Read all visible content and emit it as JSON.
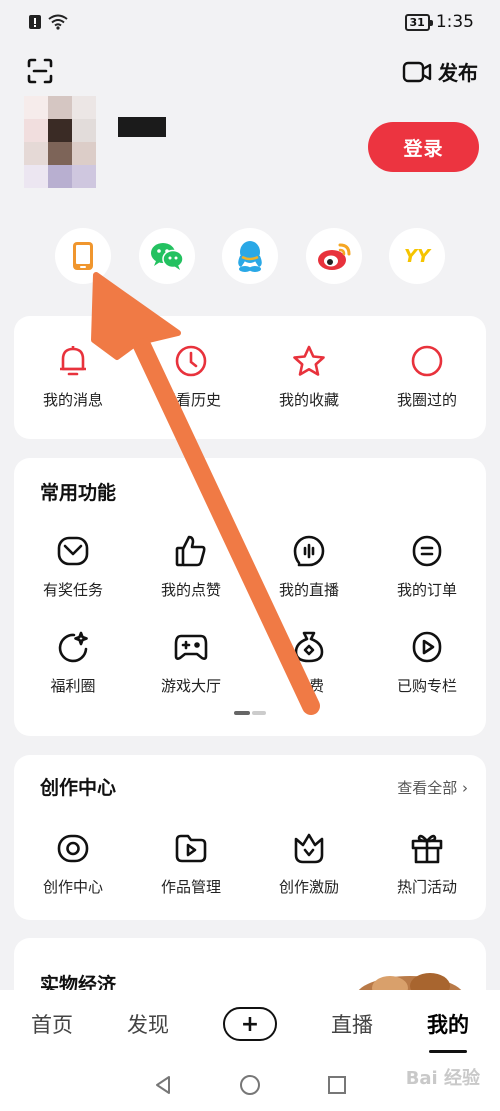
{
  "status_bar": {
    "battery": "31",
    "time": "1:35"
  },
  "header": {
    "publish_label": "发布"
  },
  "profile": {
    "login_label": "登录"
  },
  "social": [
    {
      "icon": "phone-icon",
      "color": "#f0962e"
    },
    {
      "icon": "wechat-icon",
      "color": "#23c160"
    },
    {
      "icon": "qq-icon",
      "color": "#2aa8e6"
    },
    {
      "icon": "weibo-icon",
      "color": "#e8323c"
    },
    {
      "icon": "yy-icon",
      "color": "#f5c400",
      "text": "YY"
    }
  ],
  "quick": [
    {
      "label": "我的消息",
      "icon": "bell-icon"
    },
    {
      "label": "观看历史",
      "icon": "clock-icon"
    },
    {
      "label": "我的收藏",
      "icon": "star-icon"
    },
    {
      "label": "我圈过的",
      "icon": "circle-icon"
    }
  ],
  "common": {
    "title": "常用功能",
    "row1": [
      {
        "label": "有奖任务",
        "icon": "task-icon"
      },
      {
        "label": "我的点赞",
        "icon": "thumbs-up-icon"
      },
      {
        "label": "我的直播",
        "icon": "live-icon"
      },
      {
        "label": "我的订单",
        "icon": "order-icon"
      }
    ],
    "row2": [
      {
        "label": "福利圈",
        "icon": "welfare-icon"
      },
      {
        "label": "游戏大厅",
        "icon": "gamepad-icon"
      },
      {
        "label": "话费",
        "icon": "money-bag-icon"
      },
      {
        "label": "已购专栏",
        "icon": "purchased-icon"
      }
    ]
  },
  "create": {
    "title": "创作中心",
    "view_all": "查看全部",
    "items": [
      {
        "label": "创作中心",
        "icon": "camera-icon"
      },
      {
        "label": "作品管理",
        "icon": "folder-play-icon"
      },
      {
        "label": "创作激励",
        "icon": "crown-icon"
      },
      {
        "label": "热门活动",
        "icon": "gift-icon"
      }
    ]
  },
  "goods": {
    "title": "实物经济"
  },
  "tabs": {
    "home": "首页",
    "discover": "发现",
    "live": "直播",
    "mine": "我的"
  },
  "colors": {
    "accent": "#ec3440",
    "arrow": "#f07a45"
  },
  "watermark": "Bai 经验"
}
